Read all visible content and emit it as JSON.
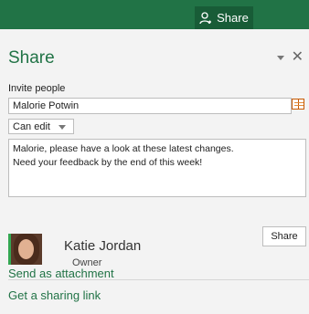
{
  "topbar": {
    "share_label": "Share",
    "accent": "#217346"
  },
  "pane": {
    "title": "Share",
    "invite_label": "Invite people",
    "invite_value": "Malorie Potwin",
    "permission": "Can edit",
    "message": "Malorie, please have a look at these latest changes.\nNeed your feedback by the end of this week!",
    "share_button": "Share"
  },
  "user": {
    "name": "Katie Jordan",
    "role": "Owner"
  },
  "links": {
    "attachment": "Send as attachment",
    "sharing_link": "Get a sharing link"
  }
}
